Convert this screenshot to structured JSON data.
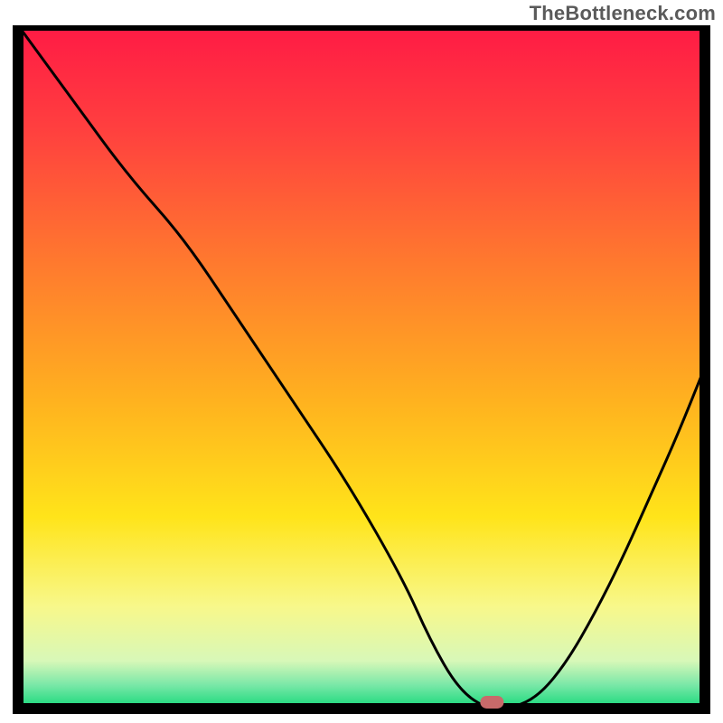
{
  "watermark": "TheBottleneck.com",
  "chart_data": {
    "type": "line",
    "title": "",
    "xlabel": "",
    "ylabel": "",
    "xlim": [
      0,
      100
    ],
    "ylim": [
      0,
      100
    ],
    "series": [
      {
        "name": "curve",
        "x": [
          0,
          8,
          16,
          24,
          32,
          40,
          48,
          56,
          60,
          64,
          68,
          72,
          76,
          80,
          84,
          88,
          92,
          96,
          100
        ],
        "y": [
          100,
          89,
          78,
          69,
          57,
          45,
          33,
          19,
          10,
          3,
          0,
          0,
          2,
          7,
          14,
          22,
          31,
          40,
          50
        ]
      }
    ],
    "marker": {
      "x": 69,
      "y": 0.8
    },
    "gradient_stops": [
      {
        "offset": 0.0,
        "color": "#ff1a45"
      },
      {
        "offset": 0.15,
        "color": "#ff3f3f"
      },
      {
        "offset": 0.35,
        "color": "#ff7a2e"
      },
      {
        "offset": 0.55,
        "color": "#ffb21f"
      },
      {
        "offset": 0.72,
        "color": "#ffe41a"
      },
      {
        "offset": 0.85,
        "color": "#f8f88a"
      },
      {
        "offset": 0.93,
        "color": "#d8f8b8"
      },
      {
        "offset": 0.965,
        "color": "#7be8a8"
      },
      {
        "offset": 1.0,
        "color": "#15d87a"
      }
    ],
    "frame_color": "#000000",
    "curve_color": "#000000",
    "marker_color": "#c86a6a"
  }
}
